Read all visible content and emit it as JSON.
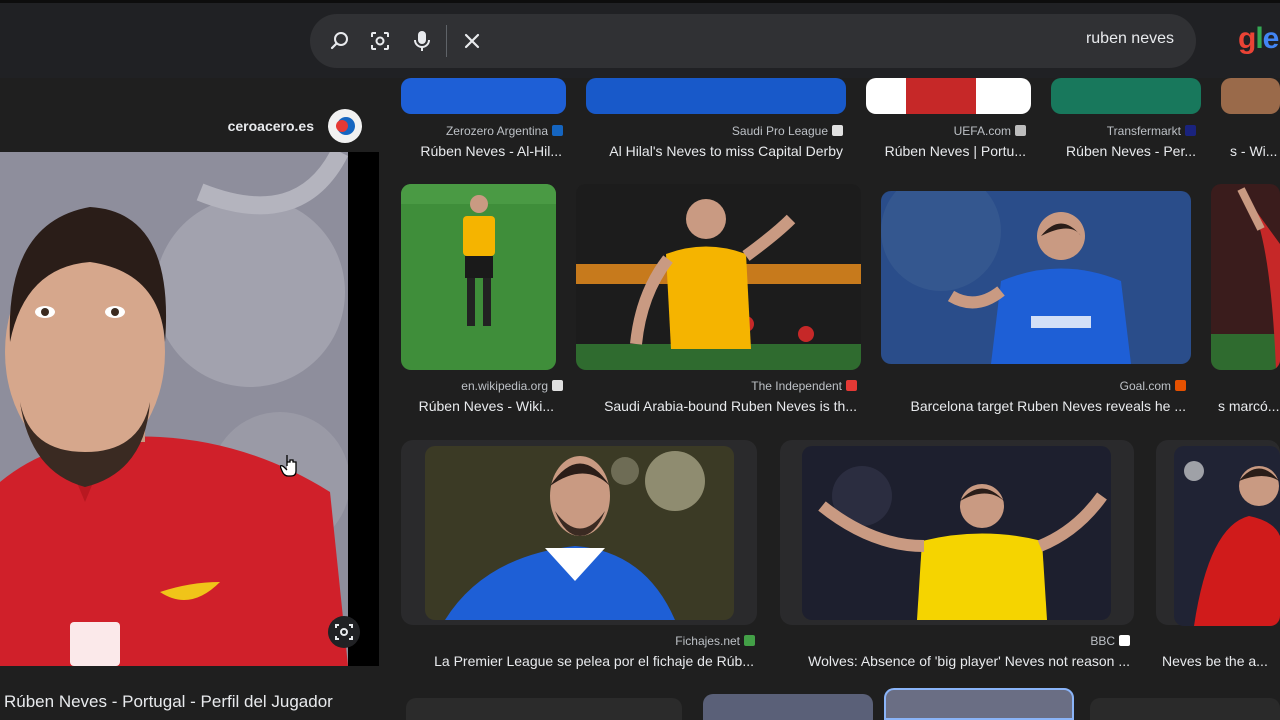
{
  "search": {
    "query": "ruben neves",
    "logo_text": "gle"
  },
  "preview": {
    "site_name": "ceroacero.es",
    "title": "Rúben Neves - Portugal - Perfil del Jugador"
  },
  "results": {
    "row1": [
      {
        "source": "Zerozero Argentina",
        "caption": "Rúben Neves - Al-Hil..."
      },
      {
        "source": "Saudi Pro League",
        "caption": "Al Hilal's Neves to miss Capital Derby"
      },
      {
        "source": "UEFA.com",
        "caption": "Rúben Neves | Portu..."
      },
      {
        "source": "Transfermarkt",
        "caption": "Rúben Neves - Per..."
      },
      {
        "source": "",
        "caption": "s - Wi..."
      }
    ],
    "row2": [
      {
        "source": "en.wikipedia.org",
        "caption": "Rúben Neves - Wiki..."
      },
      {
        "source": "The Independent",
        "caption": "Saudi Arabia-bound Ruben Neves is th..."
      },
      {
        "source": "Goal.com",
        "caption": "Barcelona target Ruben Neves reveals he ..."
      },
      {
        "source": "",
        "caption": "s marcó..."
      }
    ],
    "row3": [
      {
        "source": "Fichajes.net",
        "caption": "La Premier League se pelea por el fichaje de Rúb..."
      },
      {
        "source": "BBC",
        "caption": "Wolves: Absence of 'big player' Neves not reason ..."
      },
      {
        "source": "",
        "caption": "Neves be the a..."
      }
    ]
  },
  "colors": {
    "wolves_gold": "#f5b400",
    "hilal_blue": "#1e5fd6",
    "portugal_red": "#d01b1b",
    "pitch_green": "#3f8e3a"
  }
}
